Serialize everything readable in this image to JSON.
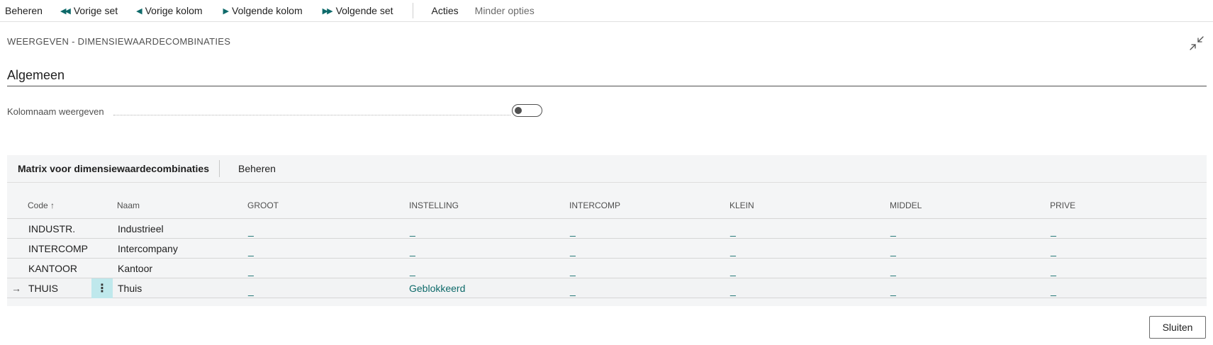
{
  "toolbar": {
    "manage": "Beheren",
    "prev_set": "Vorige set",
    "prev_column": "Vorige kolom",
    "next_column": "Volgende kolom",
    "next_set": "Volgende set",
    "actions": "Acties",
    "fewer_options": "Minder opties"
  },
  "page_title": "WEERGEVEN - DIMENSIEWAARDECOMBINATIES",
  "section": {
    "title": "Algemeen",
    "field_label": "Kolomnaam weergeven",
    "toggle_on": false
  },
  "matrix": {
    "tab_label": "Matrix voor dimensiewaardecombinaties",
    "manage": "Beheren",
    "columns": {
      "code": "Code ↑",
      "name": "Naam",
      "c1": "GROOT",
      "c2": "INSTELLING",
      "c3": "INTERCOMP",
      "c4": "KLEIN",
      "c5": "MIDDEL",
      "c6": "PRIVE"
    },
    "rows": [
      {
        "code": "INDUSTR.",
        "name": "Industrieel",
        "v": [
          "_",
          "_",
          "_",
          "_",
          "_",
          "_"
        ]
      },
      {
        "code": "INTERCOMP",
        "name": "Intercompany",
        "v": [
          "_",
          "_",
          "_",
          "_",
          "_",
          "_"
        ]
      },
      {
        "code": "KANTOOR",
        "name": "Kantoor",
        "v": [
          "_",
          "_",
          "_",
          "_",
          "_",
          "_"
        ]
      },
      {
        "code": "THUIS",
        "name": "Thuis",
        "v": [
          "_",
          "Geblokkeerd",
          "_",
          "_",
          "_",
          "_"
        ]
      }
    ],
    "current_row_indicator": "→",
    "row_menu_glyph": "⋮"
  },
  "close_button": "Sluiten",
  "icons": {
    "prev": "double-left-triangle-icon",
    "prev_col": "left-triangle-icon",
    "next_col": "right-triangle-icon",
    "next": "double-right-triangle-icon",
    "collapse": "collapse-arrows-icon"
  },
  "colors": {
    "accent": "#0e6a6a",
    "row_menu_bg": "#bfe8ec"
  }
}
